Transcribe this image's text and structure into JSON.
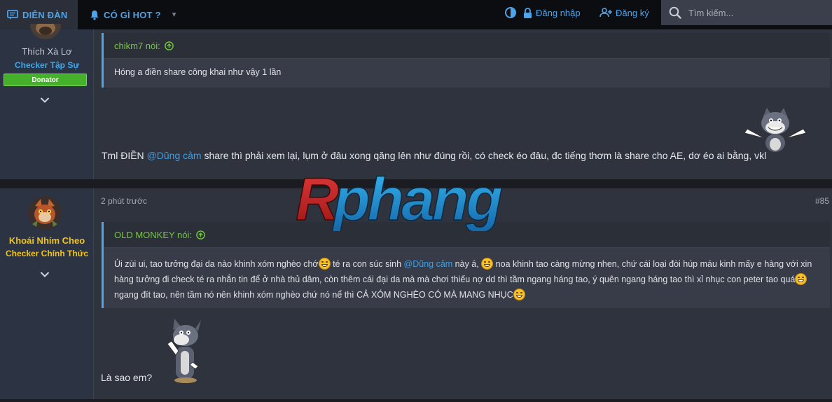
{
  "nav": {
    "forum_label": "DIỄN ĐÀN",
    "hot_label": "CÓ GÌ HOT ?",
    "login_label": "Đăng nhập",
    "register_label": "Đăng ký",
    "search_placeholder": "Tìm kiếm..."
  },
  "posts": [
    {
      "user": {
        "name": "Thích Xà Lơ",
        "title": "Checker Tập Sự",
        "badge": "Donator"
      },
      "quote": {
        "author": "chikm7 nói:",
        "text": "Hóng a điền share công khai như vậy 1 lần"
      },
      "body": {
        "pre": "Tml ĐIỀN ",
        "mention": "@Dũng cảm",
        "post": " share thì phải xem lại, lụm ở đâu xong qăng lên như đúng rồi, có check éo đâu, đc tiếng thơm là share cho AE, dơ éo ai bằng, vkl"
      }
    },
    {
      "user": {
        "name": "Khoái Nhím Cheo",
        "title": "Checker Chính Thức"
      },
      "time": "2 phút trước",
      "number": "#85",
      "quote": {
        "author": "OLD MONKEY nói:",
        "t1": "Úi zùi ui, tao tưởng đại da nào khinh xóm nghèo chớ",
        "t2": " té ra con súc sinh ",
        "mention": "@Dũng cảm",
        "t3": " này á, ",
        "t4": " noa khinh tao càng mừng nhen, chứ cái loại đòi húp máu kinh mấy e hàng với xin hàng tưởng đi check té ra nhắn tin để ở nhà thủ dâm, còn thêm cái đại da mà mà chơi thiếu nợ dd thì tầm ngang háng tao, ý quên ngang háng tao thì xỉ nhục con peter tao quá",
        "t5": "ngang đít tao, nên tầm nó nên khinh xóm nghèo chứ nó nể thì CẢ XÓM NGHÈO CÓ MÀ MANG NHỤC"
      },
      "body": {
        "text": "Là sao em?"
      }
    }
  ],
  "watermark": {
    "text": "Rphang"
  },
  "colors": {
    "accent": "#4fa3e8",
    "quote_author": "#74c93a",
    "donator": "#45b02a",
    "rank_gold": "#f0c419",
    "rank_blue": "#38a8f2"
  },
  "icons": [
    "forum-icon",
    "bell-icon",
    "chevron-down-icon",
    "theme-toggle-icon",
    "lock-icon",
    "user-plus-icon",
    "search-icon",
    "arrow-up-circle-icon",
    "expand-chevron-icon",
    "grin-emoji-icon"
  ]
}
